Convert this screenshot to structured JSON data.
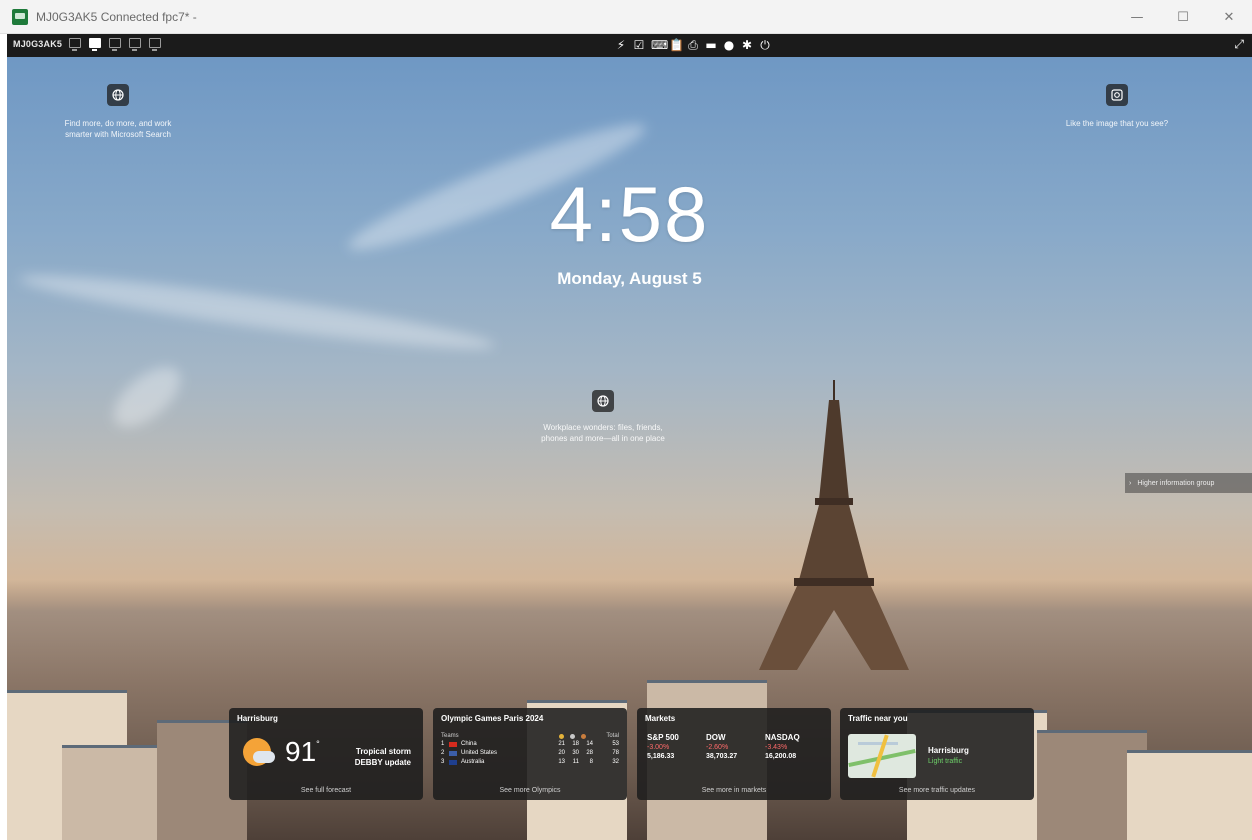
{
  "window": {
    "title": "MJ0G3AK5 Connected fpc7* -",
    "controls": {
      "minimize": "—",
      "maximize": "☐",
      "close": "✕"
    }
  },
  "toolbar": {
    "host": "MJ0G3AK5",
    "monitor_icons": [
      "all-monitors-icon",
      "monitor-1-icon",
      "monitor-2-icon",
      "monitor-3-icon",
      "monitor-4-icon"
    ],
    "tools": [
      {
        "name": "lightning-icon",
        "glyph": "⚡"
      },
      {
        "name": "checklist-icon",
        "glyph": "☑"
      },
      {
        "name": "keyboard-icon",
        "glyph": "⌨"
      },
      {
        "name": "clipboard-icon",
        "glyph": "📋"
      },
      {
        "name": "printer-icon",
        "glyph": "⎙"
      },
      {
        "name": "folder-icon",
        "glyph": "▬"
      },
      {
        "name": "chat-icon",
        "glyph": "●"
      },
      {
        "name": "gear-icon",
        "glyph": "✱"
      },
      {
        "name": "power-icon",
        "glyph": "⏻"
      }
    ],
    "fullscreen_glyph": "⤢"
  },
  "lockscreen": {
    "time": "4:58",
    "date": "Monday, August 5",
    "search_hint_line1": "Find more, do more, and work",
    "search_hint_line2": "smarter with Microsoft Search",
    "image_hint": "Like the image that you see?",
    "workplace_hint_line1": "Workplace wonders: files, friends,",
    "workplace_hint_line2": "phones and more—all in one place",
    "side_chip": "Higher information group"
  },
  "widgets": {
    "weather": {
      "title": "Harrisburg",
      "temp": "91",
      "unit": "°",
      "alert_line1": "Tropical storm",
      "alert_line2": "DEBBY update",
      "footer": "See full forecast"
    },
    "olympics": {
      "title": "Olympic Games Paris 2024",
      "teams_label": "Teams",
      "total_label": "Total",
      "medal_colors": [
        "#e5b33a",
        "#c8c8c8",
        "#c97d3d"
      ],
      "rows": [
        {
          "rank": "1",
          "country": "China",
          "gold": "21",
          "silver": "18",
          "bronze": "14",
          "total": "53",
          "flag": "#d52b1e"
        },
        {
          "rank": "2",
          "country": "United States",
          "gold": "20",
          "silver": "30",
          "bronze": "28",
          "total": "78",
          "flag": "#3c5ea8"
        },
        {
          "rank": "3",
          "country": "Australia",
          "gold": "13",
          "silver": "11",
          "bronze": "8",
          "total": "32",
          "flag": "#1f3f8f"
        }
      ],
      "footer": "See more Olympics"
    },
    "markets": {
      "title": "Markets",
      "items": [
        {
          "name": "S&P 500",
          "pct": "-3.00%",
          "val": "5,186.33"
        },
        {
          "name": "DOW",
          "pct": "-2.60%",
          "val": "38,703.27"
        },
        {
          "name": "NASDAQ",
          "pct": "-3.43%",
          "val": "16,200.08"
        }
      ],
      "footer": "See more in markets"
    },
    "traffic": {
      "title": "Traffic near you",
      "city": "Harrisburg",
      "status": "Light traffic",
      "footer": "See more traffic updates"
    }
  }
}
